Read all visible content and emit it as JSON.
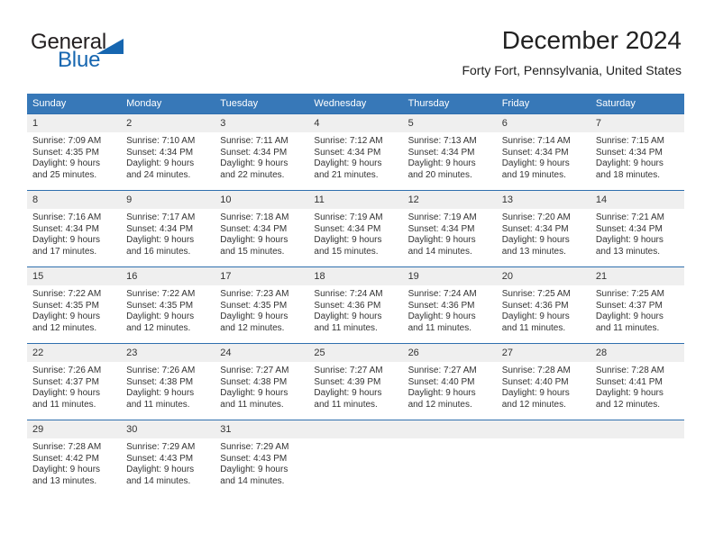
{
  "brand": {
    "name_top": "General",
    "name_bottom": "Blue",
    "accent_color": "#1666b0"
  },
  "header": {
    "month_title": "December 2024",
    "location": "Forty Fort, Pennsylvania, United States"
  },
  "calendar": {
    "header_bg": "#3778b8",
    "daynum_bg": "#efefef",
    "row_border_color": "#2f6fae",
    "weekdays": [
      "Sunday",
      "Monday",
      "Tuesday",
      "Wednesday",
      "Thursday",
      "Friday",
      "Saturday"
    ],
    "weeks": [
      [
        {
          "day": "1",
          "sunrise": "Sunrise: 7:09 AM",
          "sunset": "Sunset: 4:35 PM",
          "daylight1": "Daylight: 9 hours",
          "daylight2": "and 25 minutes."
        },
        {
          "day": "2",
          "sunrise": "Sunrise: 7:10 AM",
          "sunset": "Sunset: 4:34 PM",
          "daylight1": "Daylight: 9 hours",
          "daylight2": "and 24 minutes."
        },
        {
          "day": "3",
          "sunrise": "Sunrise: 7:11 AM",
          "sunset": "Sunset: 4:34 PM",
          "daylight1": "Daylight: 9 hours",
          "daylight2": "and 22 minutes."
        },
        {
          "day": "4",
          "sunrise": "Sunrise: 7:12 AM",
          "sunset": "Sunset: 4:34 PM",
          "daylight1": "Daylight: 9 hours",
          "daylight2": "and 21 minutes."
        },
        {
          "day": "5",
          "sunrise": "Sunrise: 7:13 AM",
          "sunset": "Sunset: 4:34 PM",
          "daylight1": "Daylight: 9 hours",
          "daylight2": "and 20 minutes."
        },
        {
          "day": "6",
          "sunrise": "Sunrise: 7:14 AM",
          "sunset": "Sunset: 4:34 PM",
          "daylight1": "Daylight: 9 hours",
          "daylight2": "and 19 minutes."
        },
        {
          "day": "7",
          "sunrise": "Sunrise: 7:15 AM",
          "sunset": "Sunset: 4:34 PM",
          "daylight1": "Daylight: 9 hours",
          "daylight2": "and 18 minutes."
        }
      ],
      [
        {
          "day": "8",
          "sunrise": "Sunrise: 7:16 AM",
          "sunset": "Sunset: 4:34 PM",
          "daylight1": "Daylight: 9 hours",
          "daylight2": "and 17 minutes."
        },
        {
          "day": "9",
          "sunrise": "Sunrise: 7:17 AM",
          "sunset": "Sunset: 4:34 PM",
          "daylight1": "Daylight: 9 hours",
          "daylight2": "and 16 minutes."
        },
        {
          "day": "10",
          "sunrise": "Sunrise: 7:18 AM",
          "sunset": "Sunset: 4:34 PM",
          "daylight1": "Daylight: 9 hours",
          "daylight2": "and 15 minutes."
        },
        {
          "day": "11",
          "sunrise": "Sunrise: 7:19 AM",
          "sunset": "Sunset: 4:34 PM",
          "daylight1": "Daylight: 9 hours",
          "daylight2": "and 15 minutes."
        },
        {
          "day": "12",
          "sunrise": "Sunrise: 7:19 AM",
          "sunset": "Sunset: 4:34 PM",
          "daylight1": "Daylight: 9 hours",
          "daylight2": "and 14 minutes."
        },
        {
          "day": "13",
          "sunrise": "Sunrise: 7:20 AM",
          "sunset": "Sunset: 4:34 PM",
          "daylight1": "Daylight: 9 hours",
          "daylight2": "and 13 minutes."
        },
        {
          "day": "14",
          "sunrise": "Sunrise: 7:21 AM",
          "sunset": "Sunset: 4:34 PM",
          "daylight1": "Daylight: 9 hours",
          "daylight2": "and 13 minutes."
        }
      ],
      [
        {
          "day": "15",
          "sunrise": "Sunrise: 7:22 AM",
          "sunset": "Sunset: 4:35 PM",
          "daylight1": "Daylight: 9 hours",
          "daylight2": "and 12 minutes."
        },
        {
          "day": "16",
          "sunrise": "Sunrise: 7:22 AM",
          "sunset": "Sunset: 4:35 PM",
          "daylight1": "Daylight: 9 hours",
          "daylight2": "and 12 minutes."
        },
        {
          "day": "17",
          "sunrise": "Sunrise: 7:23 AM",
          "sunset": "Sunset: 4:35 PM",
          "daylight1": "Daylight: 9 hours",
          "daylight2": "and 12 minutes."
        },
        {
          "day": "18",
          "sunrise": "Sunrise: 7:24 AM",
          "sunset": "Sunset: 4:36 PM",
          "daylight1": "Daylight: 9 hours",
          "daylight2": "and 11 minutes."
        },
        {
          "day": "19",
          "sunrise": "Sunrise: 7:24 AM",
          "sunset": "Sunset: 4:36 PM",
          "daylight1": "Daylight: 9 hours",
          "daylight2": "and 11 minutes."
        },
        {
          "day": "20",
          "sunrise": "Sunrise: 7:25 AM",
          "sunset": "Sunset: 4:36 PM",
          "daylight1": "Daylight: 9 hours",
          "daylight2": "and 11 minutes."
        },
        {
          "day": "21",
          "sunrise": "Sunrise: 7:25 AM",
          "sunset": "Sunset: 4:37 PM",
          "daylight1": "Daylight: 9 hours",
          "daylight2": "and 11 minutes."
        }
      ],
      [
        {
          "day": "22",
          "sunrise": "Sunrise: 7:26 AM",
          "sunset": "Sunset: 4:37 PM",
          "daylight1": "Daylight: 9 hours",
          "daylight2": "and 11 minutes."
        },
        {
          "day": "23",
          "sunrise": "Sunrise: 7:26 AM",
          "sunset": "Sunset: 4:38 PM",
          "daylight1": "Daylight: 9 hours",
          "daylight2": "and 11 minutes."
        },
        {
          "day": "24",
          "sunrise": "Sunrise: 7:27 AM",
          "sunset": "Sunset: 4:38 PM",
          "daylight1": "Daylight: 9 hours",
          "daylight2": "and 11 minutes."
        },
        {
          "day": "25",
          "sunrise": "Sunrise: 7:27 AM",
          "sunset": "Sunset: 4:39 PM",
          "daylight1": "Daylight: 9 hours",
          "daylight2": "and 11 minutes."
        },
        {
          "day": "26",
          "sunrise": "Sunrise: 7:27 AM",
          "sunset": "Sunset: 4:40 PM",
          "daylight1": "Daylight: 9 hours",
          "daylight2": "and 12 minutes."
        },
        {
          "day": "27",
          "sunrise": "Sunrise: 7:28 AM",
          "sunset": "Sunset: 4:40 PM",
          "daylight1": "Daylight: 9 hours",
          "daylight2": "and 12 minutes."
        },
        {
          "day": "28",
          "sunrise": "Sunrise: 7:28 AM",
          "sunset": "Sunset: 4:41 PM",
          "daylight1": "Daylight: 9 hours",
          "daylight2": "and 12 minutes."
        }
      ],
      [
        {
          "day": "29",
          "sunrise": "Sunrise: 7:28 AM",
          "sunset": "Sunset: 4:42 PM",
          "daylight1": "Daylight: 9 hours",
          "daylight2": "and 13 minutes."
        },
        {
          "day": "30",
          "sunrise": "Sunrise: 7:29 AM",
          "sunset": "Sunset: 4:43 PM",
          "daylight1": "Daylight: 9 hours",
          "daylight2": "and 14 minutes."
        },
        {
          "day": "31",
          "sunrise": "Sunrise: 7:29 AM",
          "sunset": "Sunset: 4:43 PM",
          "daylight1": "Daylight: 9 hours",
          "daylight2": "and 14 minutes."
        },
        {
          "day": "",
          "sunrise": "",
          "sunset": "",
          "daylight1": "",
          "daylight2": ""
        },
        {
          "day": "",
          "sunrise": "",
          "sunset": "",
          "daylight1": "",
          "daylight2": ""
        },
        {
          "day": "",
          "sunrise": "",
          "sunset": "",
          "daylight1": "",
          "daylight2": ""
        },
        {
          "day": "",
          "sunrise": "",
          "sunset": "",
          "daylight1": "",
          "daylight2": ""
        }
      ]
    ]
  }
}
